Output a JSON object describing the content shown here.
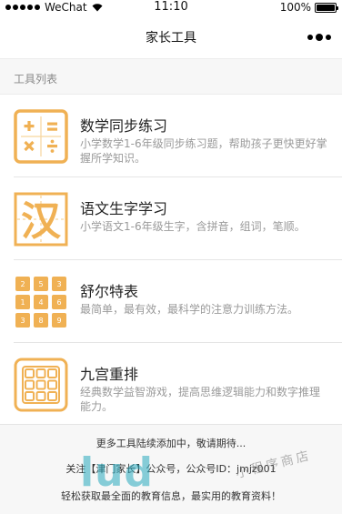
{
  "status_bar": {
    "carrier": "WeChat",
    "time": "11:10",
    "battery": "100%",
    "battery_level": 1.0
  },
  "nav": {
    "title": "家长工具"
  },
  "section": {
    "label": "工具列表"
  },
  "tools": [
    {
      "title": "数学同步练习",
      "desc": "小学数学1-6年级同步练习题，帮助孩子更快更好掌握所学知识。",
      "icon": "math-operators-icon"
    },
    {
      "title": "语文生字学习",
      "desc": "小学语文1-6年级生字，含拼音，组词，笔顺。",
      "icon": "chinese-character-icon"
    },
    {
      "title": "舒尔特表",
      "desc": "最简单，最有效，最科学的注意力训练方法。",
      "icon": "number-grid-icon"
    },
    {
      "title": "九宫重排",
      "desc": "经典数学益智游戏，提高思维逻辑能力和数字推理能力。",
      "icon": "nine-grid-icon"
    }
  ],
  "icon_glyphs": {
    "chinese_char": "汉",
    "schulte_numbers": [
      "2",
      "5",
      "3",
      "1",
      "4",
      "6",
      "3",
      "8",
      "9"
    ]
  },
  "footer": {
    "line1": "更多工具陆续添加中，敬请期待...",
    "line2": "关注【津门家长】公众号，公众号ID：jmjz001",
    "line3": "轻松获取最全面的教育信息，最实用的教育资料！"
  },
  "watermark": {
    "brand": "lud",
    "shop": "小程序商店"
  },
  "colors": {
    "accent": "#f0b154",
    "accent_light": "#f7d69e",
    "muted_text": "#9a9a9a"
  }
}
